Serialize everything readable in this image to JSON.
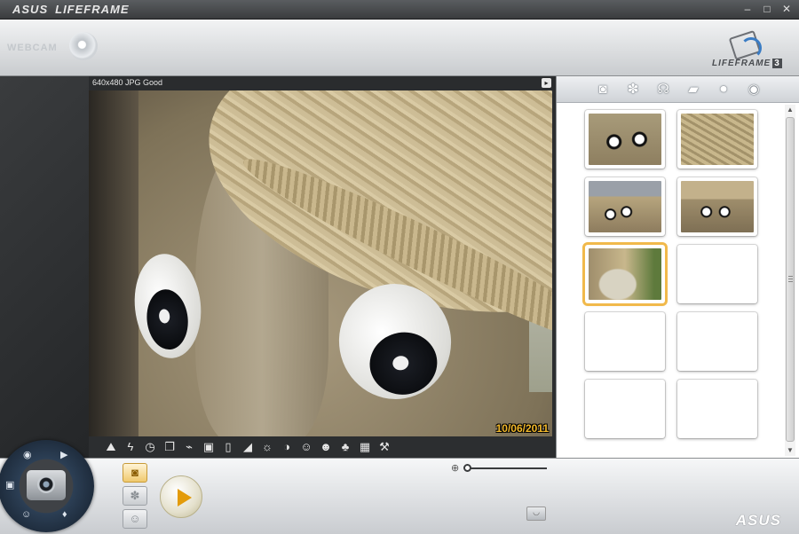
{
  "window": {
    "brand": "ASUS",
    "app_title": "LIFEFRAME",
    "minimize_glyph": "‒",
    "maximize_glyph": "□",
    "close_glyph": "✕"
  },
  "header": {
    "webcam_label": "WEBCAM",
    "product_name": "LIFEFRAME",
    "product_version": "3"
  },
  "preview": {
    "format_label": "640x480 JPG Good",
    "options_glyph": "▸",
    "timestamp": "10/06/2011"
  },
  "toolbar": {
    "icons": [
      {
        "name": "landscape-icon",
        "glyph": "⛰"
      },
      {
        "name": "flash-icon",
        "glyph": "ϟ"
      },
      {
        "name": "timer-icon",
        "glyph": "◷"
      },
      {
        "name": "burst-icon",
        "glyph": "❐"
      },
      {
        "name": "measure-icon",
        "glyph": "⌁"
      },
      {
        "name": "frame-icon",
        "glyph": "▣"
      },
      {
        "name": "portrait-frame-icon",
        "glyph": "▯"
      },
      {
        "name": "exposure-icon",
        "glyph": "◢"
      },
      {
        "name": "brightness-icon",
        "glyph": "☼"
      },
      {
        "name": "contrast-icon",
        "glyph": "◑"
      },
      {
        "name": "face-mask-icon",
        "glyph": "☺"
      },
      {
        "name": "face-track-icon",
        "glyph": "☻"
      },
      {
        "name": "color-icon",
        "glyph": "♣"
      },
      {
        "name": "effects-icon",
        "glyph": "▦"
      },
      {
        "name": "settings-wrench-icon",
        "glyph": "⚒"
      }
    ]
  },
  "gallery": {
    "tabs": [
      {
        "name": "tab-photo",
        "glyph": "◙"
      },
      {
        "name": "tab-effects",
        "glyph": "✽"
      },
      {
        "name": "tab-face",
        "glyph": "☊"
      },
      {
        "name": "tab-video",
        "glyph": "▰"
      },
      {
        "name": "tab-audio",
        "glyph": "⏺"
      },
      {
        "name": "tab-view",
        "glyph": "◉"
      }
    ]
  },
  "controls": {
    "modes": [
      {
        "name": "photo-mode-button",
        "glyph": "◙"
      },
      {
        "name": "effects-mode-button",
        "glyph": "✽"
      },
      {
        "name": "face-mode-button",
        "glyph": "☺"
      }
    ],
    "zoom_glyph": "⊕",
    "zoom_level": 0,
    "snapshot_glyph": "◡",
    "footer_brand": "ASUS"
  },
  "colors": {
    "accent_selected": "#f1b94b",
    "record": "#e39b0a",
    "timestamp": "#f3b92a"
  }
}
